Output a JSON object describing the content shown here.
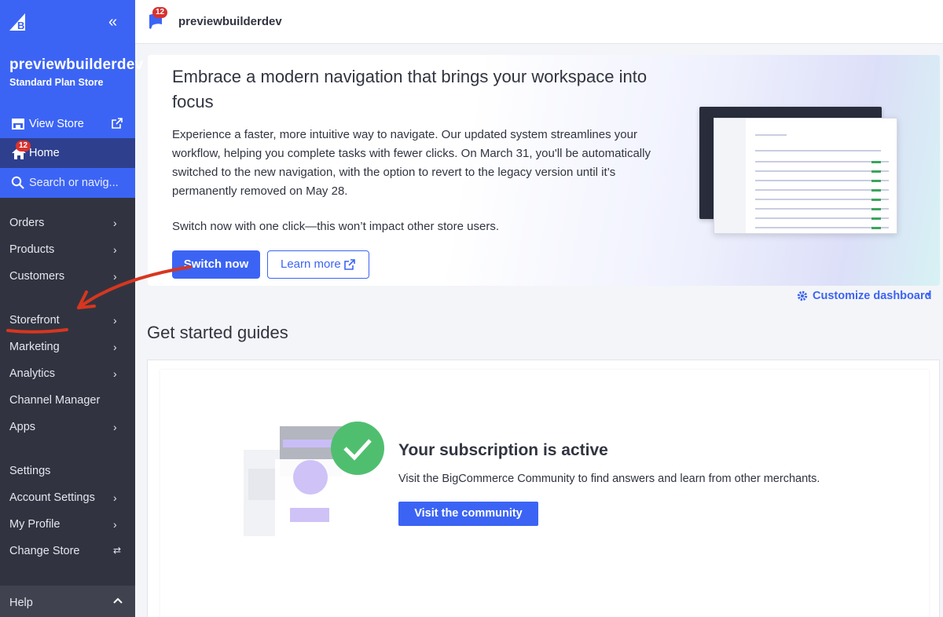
{
  "topbar": {
    "notification_count": "12",
    "store_name": "previewbuilderdev"
  },
  "sidebar": {
    "store_name": "previewbuilderdev",
    "plan": "Standard Plan Store",
    "view_store": "View Store",
    "home": {
      "label": "Home",
      "badge": "12"
    },
    "search_placeholder": "Search or navig...",
    "items": [
      {
        "label": "Orders",
        "chevron": "›"
      },
      {
        "label": "Products",
        "chevron": "›"
      },
      {
        "label": "Customers",
        "chevron": "›"
      },
      {
        "label": "Storefront",
        "chevron": "›"
      },
      {
        "label": "Marketing",
        "chevron": "›"
      },
      {
        "label": "Analytics",
        "chevron": "›"
      },
      {
        "label": "Channel Manager",
        "chevron": ""
      },
      {
        "label": "Apps",
        "chevron": "›"
      },
      {
        "label": "Settings",
        "chevron": ""
      },
      {
        "label": "Account Settings",
        "chevron": "›"
      },
      {
        "label": "My Profile",
        "chevron": "›"
      },
      {
        "label": "Change Store",
        "chevron": "⇄"
      }
    ],
    "help": "Help"
  },
  "banner": {
    "title": "Embrace a modern navigation that brings your workspace into focus",
    "body": "Experience a faster, more intuitive way to navigate. Our updated system streamlines your workflow, helping you complete tasks with fewer clicks. On March 31, you'll be automatically switched to the new navigation, with the option to revert to the legacy version until it’s permanently removed on May 28.",
    "subtext": "Switch now with one click—this won’t impact other store users.",
    "switch_button": "Switch now",
    "learn_button": "Learn more"
  },
  "customize_dashboard": "Customize dashboard",
  "guides": {
    "title": "Get started guides",
    "subscription_title": "Your subscription is active",
    "subscription_text": "Visit the BigCommerce Community to find answers and learn from other merchants.",
    "community_button": "Visit the community"
  },
  "colors": {
    "brand_blue": "#3c64f4",
    "sidebar_dark": "#313440",
    "badge_red": "#d9322e",
    "success_green": "#4fbf6f"
  }
}
